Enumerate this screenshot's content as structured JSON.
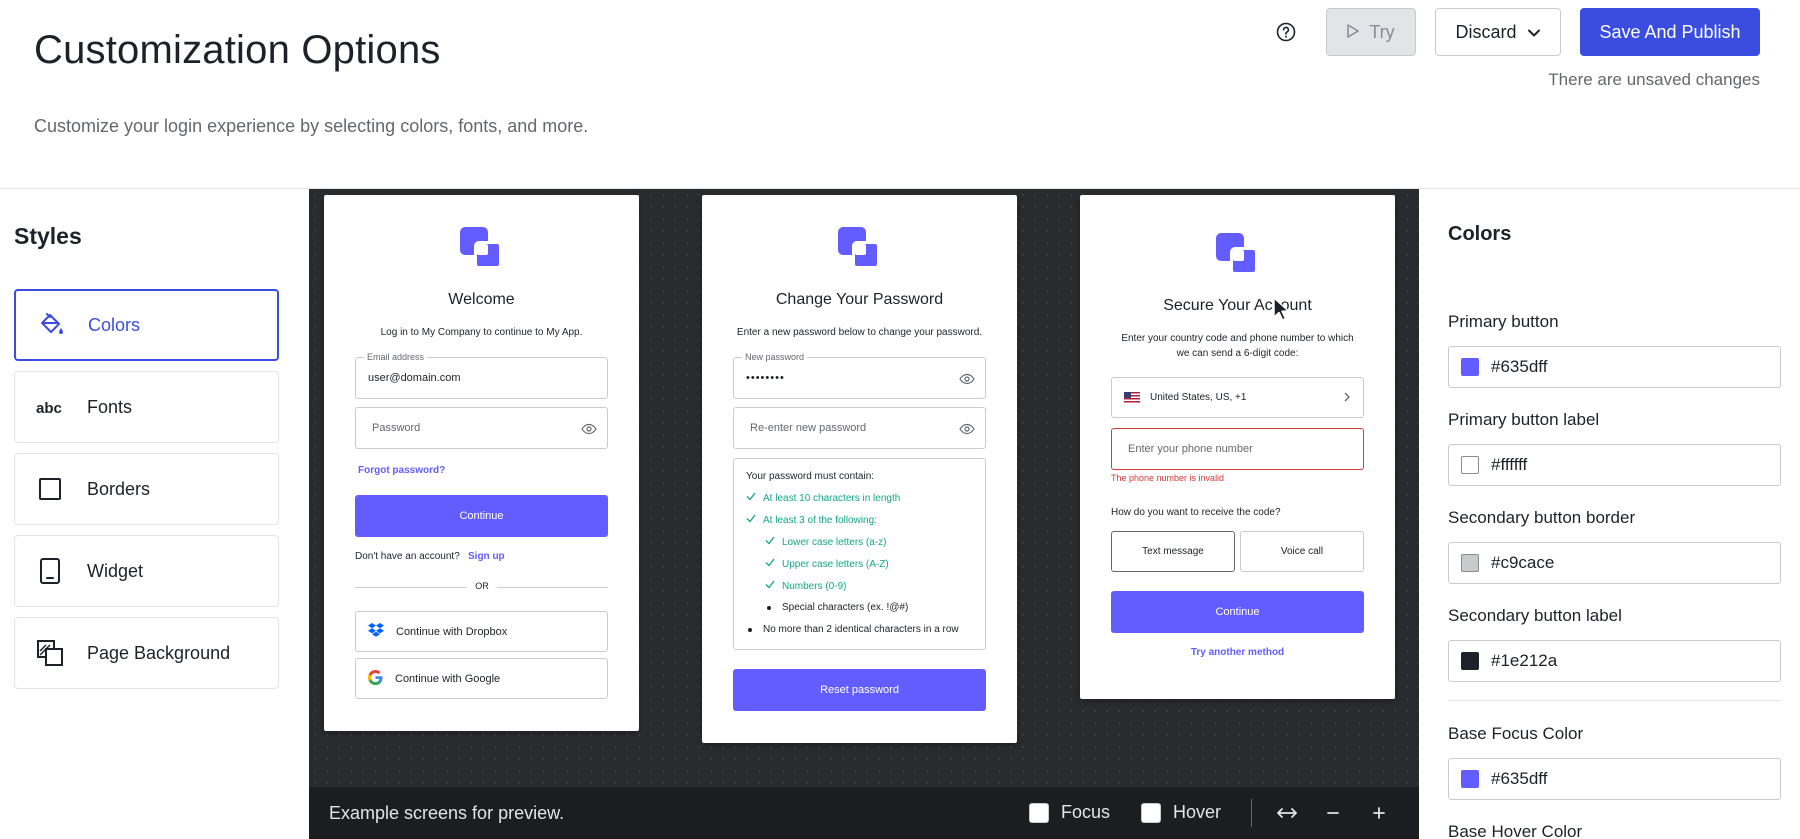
{
  "header": {
    "title": "Customization Options",
    "subtitle": "Customize your login experience by selecting colors, fonts, and more.",
    "try_label": "Try",
    "discard_label": "Discard",
    "save_label": "Save And Publish",
    "unsaved_text": "There are unsaved changes"
  },
  "sidebar": {
    "title": "Styles",
    "items": [
      {
        "label": "Colors",
        "icon": "paint-bucket-icon",
        "active": true
      },
      {
        "label": "Fonts",
        "icon": "abc-icon"
      },
      {
        "label": "Borders",
        "icon": "square-outline-icon"
      },
      {
        "label": "Widget",
        "icon": "phone-widget-icon"
      },
      {
        "label": "Page Background",
        "icon": "background-icon"
      }
    ]
  },
  "preview": {
    "login": {
      "title": "Welcome",
      "description": "Log in to My Company to continue to My App.",
      "email_label": "Email address",
      "email_value": "user@domain.com",
      "password_placeholder": "Password",
      "forgot": "Forgot password?",
      "continue": "Continue",
      "no_account": "Don't have an account?",
      "sign_up": "Sign up",
      "or": "OR",
      "dropbox": "Continue with Dropbox",
      "google": "Continue with Google"
    },
    "change_password": {
      "title": "Change Your Password",
      "description": "Enter a new password below to change your password.",
      "new_label": "New password",
      "new_value": "••••••••",
      "reenter_placeholder": "Re-enter new password",
      "must_contain": "Your password must contain:",
      "rules": [
        {
          "text": "At least 10 characters in length",
          "ok": true,
          "indent": 0
        },
        {
          "text": "At least 3 of the following:",
          "ok": true,
          "indent": 0
        },
        {
          "text": "Lower case letters (a-z)",
          "ok": true,
          "indent": 1
        },
        {
          "text": "Upper case letters (A-Z)",
          "ok": true,
          "indent": 1
        },
        {
          "text": "Numbers (0-9)",
          "ok": true,
          "indent": 1
        },
        {
          "text": "Special characters (ex. !@#)",
          "ok": false,
          "indent": 1
        },
        {
          "text": "No more than 2 identical characters in a row",
          "ok": false,
          "indent": 0
        }
      ],
      "reset": "Reset password"
    },
    "secure": {
      "title": "Secure Your Account",
      "description": "Enter your country code and phone number to which we can send a 6-digit code:",
      "country": "United States, US, +1",
      "phone_placeholder": "Enter your phone number",
      "error": "The phone number is invalid",
      "question": "How do you want to receive the code?",
      "text_message": "Text message",
      "voice_call": "Voice call",
      "continue": "Continue",
      "try_another": "Try another method"
    },
    "toolbar": {
      "note": "Example screens for preview.",
      "focus": "Focus",
      "hover": "Hover"
    }
  },
  "colors_panel": {
    "title": "Colors",
    "fields": [
      {
        "label": "Primary button",
        "value": "#635dff"
      },
      {
        "label": "Primary button label",
        "value": "#ffffff"
      },
      {
        "label": "Secondary button border",
        "value": "#c9cace"
      },
      {
        "label": "Secondary button label",
        "value": "#1e212a"
      },
      {
        "label": "Base Focus Color",
        "value": "#635dff"
      },
      {
        "label": "Base Hover Color",
        "value": ""
      }
    ]
  },
  "theme": {
    "accent": "#3a4de0",
    "primary": "#635dff",
    "success": "#13a688",
    "error": "#d03c38"
  }
}
